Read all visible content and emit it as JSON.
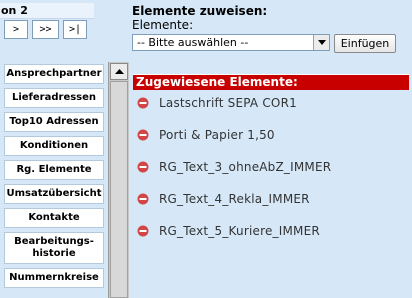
{
  "pager": {
    "title": "on 2",
    "buttons": [
      ">",
      ">>",
      ">|"
    ]
  },
  "assign": {
    "title": "Elemente zuweisen:",
    "sublabel": "Elemente:",
    "select_value": "-- Bitte auswählen --",
    "add_label": "Einfügen"
  },
  "menu": {
    "items": [
      "Ansprechpartner",
      "Lieferadressen",
      "Top10 Adressen",
      "Konditionen",
      "Rg. Elemente",
      "Umsatzübersicht",
      "Kontakte",
      "Bearbeitungs-\nhistorie",
      "Nummernkreise"
    ]
  },
  "assigned": {
    "header": "Zugewiesene Elemente:",
    "items": [
      "Lastschrift SEPA COR1",
      "Porti & Papier 1,50",
      "RG_Text_3_ohneAbZ_IMMER",
      "RG_Text_4_Rekla_IMMER",
      "RG_Text_5_Kuriere_IMMER"
    ]
  },
  "icons": {
    "remove": "remove-circle-icon",
    "dropdown": "chevron-down-icon",
    "scroll_up": "arrow-up-icon"
  },
  "colors": {
    "page_background": "#d6e8f8",
    "header_red": "#c80000",
    "remove_icon": "#d24646"
  }
}
